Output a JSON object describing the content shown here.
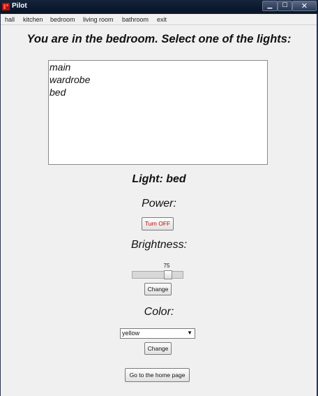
{
  "window": {
    "title": "Pilot",
    "controls": {
      "minimize": "▁",
      "maximize": "☐",
      "close": "✕"
    }
  },
  "menu": [
    "hall",
    "kitchen",
    "bedroom",
    "living room",
    "bathroom",
    "exit"
  ],
  "main": {
    "heading": "You are in the bedroom. Select one of the lights:",
    "lights": [
      "main",
      "wardrobe",
      "bed"
    ],
    "light_label": "Light: bed",
    "power_label": "Power:",
    "power_button": "Turn OFF",
    "brightness_label": "Brightness:",
    "brightness_value": 75,
    "brightness_fraction": 0.75,
    "change_button": "Change",
    "color_label": "Color:",
    "color_selected": "yellow",
    "color_change_button": "Change",
    "home_button": "Go to the home page"
  },
  "colors": {
    "titlebar": "#0b1a30",
    "power_button_text": "#c00000"
  }
}
